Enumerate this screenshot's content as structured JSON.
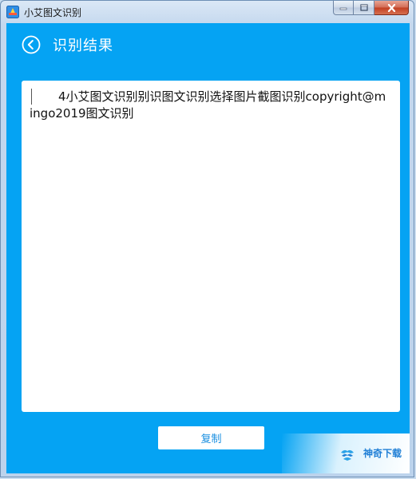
{
  "window": {
    "title": "小艾图文识别",
    "controls": [
      "minimize-icon",
      "maximize-icon",
      "close-icon"
    ]
  },
  "header": {
    "back_icon": "chevron-left-circle-icon",
    "title": "识别结果"
  },
  "result": {
    "text": "4小艾图文识别别识图文识别选择图片截图识别copyright@mingo2019图文识别"
  },
  "actions": {
    "copy_label": "复制"
  },
  "watermark": {
    "text": "神奇下载"
  },
  "colors": {
    "accent": "#05a3f3",
    "panel": "#ffffff",
    "button_text": "#1a8fe0"
  }
}
